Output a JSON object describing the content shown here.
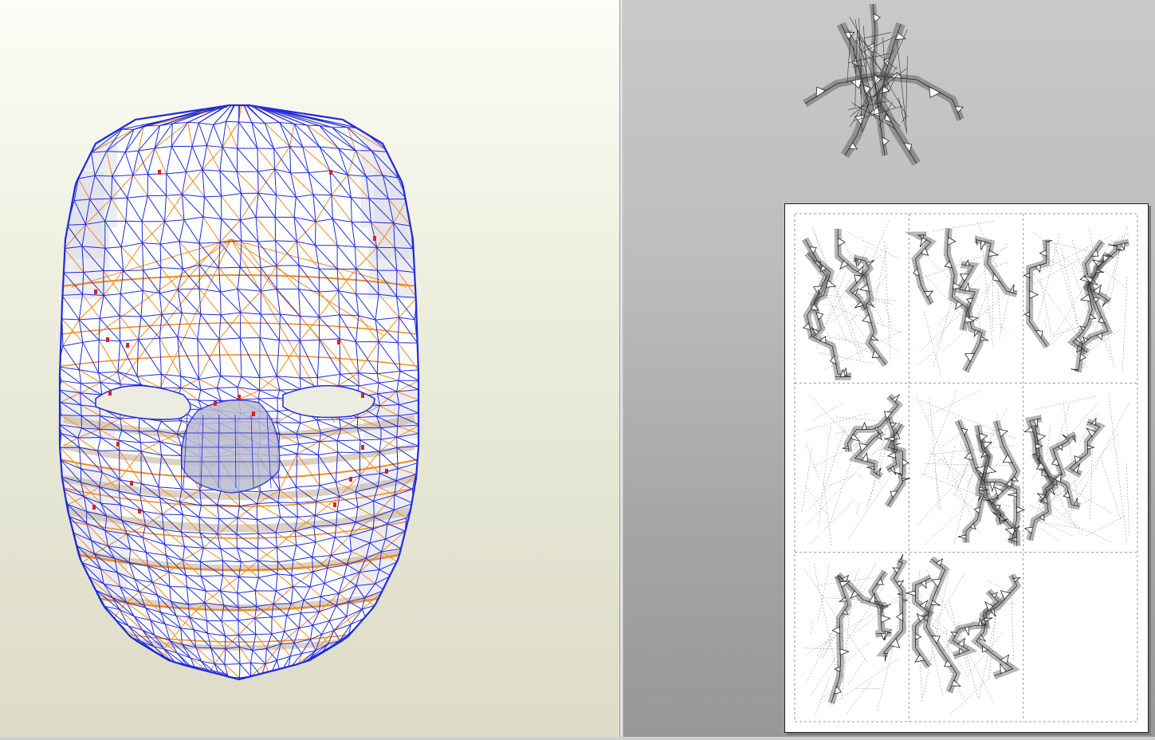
{
  "view3d": {
    "background_top": "#fdfdf8",
    "background_bottom": "#dcdcc8",
    "mesh_color": "#1f2bdc",
    "fold_color": "#f08a1c",
    "cut_color": "#e02020",
    "model_icon": "mask-wireframe-icon"
  },
  "view2d": {
    "background": "#b4b4b4",
    "page_grid": {
      "columns": 3,
      "rows": 3,
      "filled_cells": 8
    },
    "part_icon": "thorn-crown-icon",
    "line_color": "#222222"
  }
}
